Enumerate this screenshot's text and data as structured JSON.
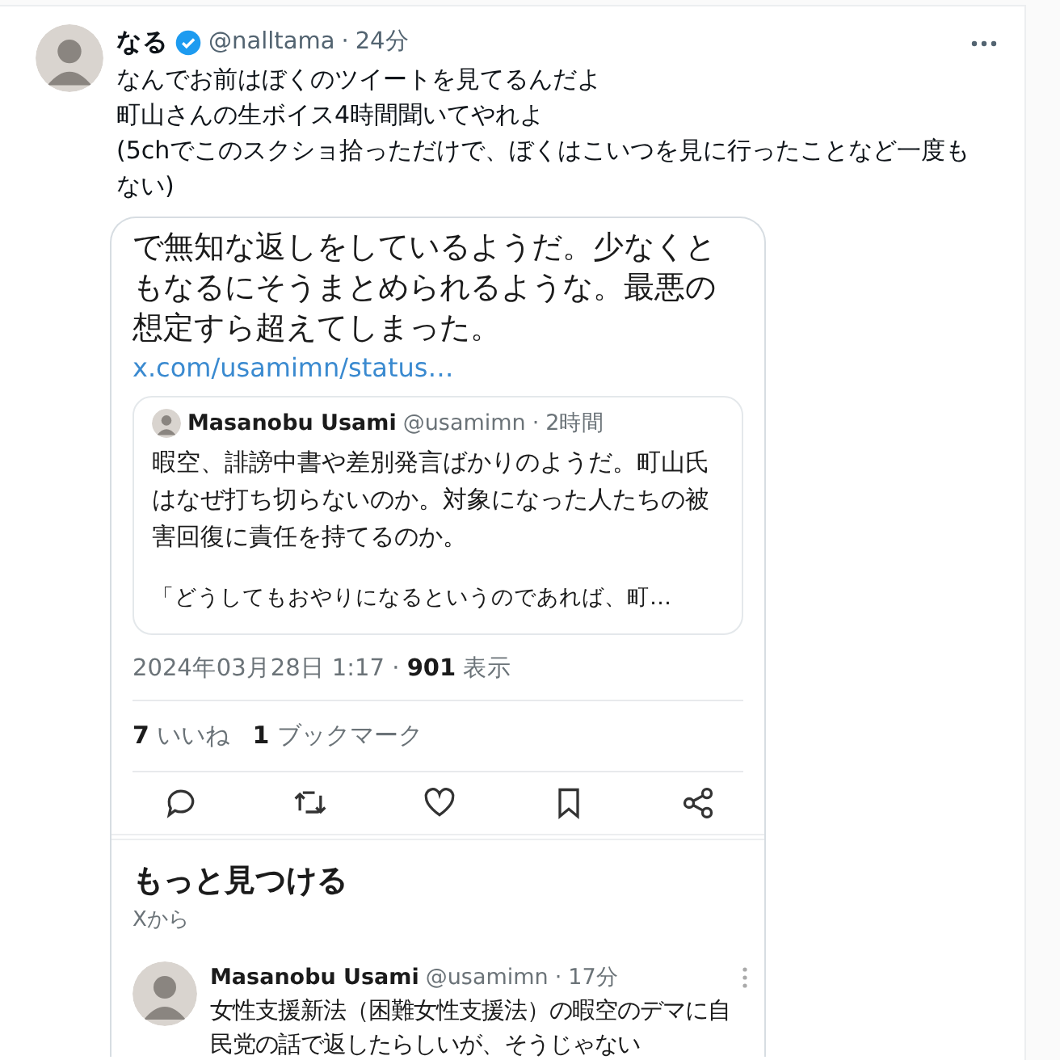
{
  "post": {
    "display_name": "なる",
    "verified": true,
    "handle": "@nalltama",
    "dot": "·",
    "time": "24分",
    "paragraphs": [
      "なんでお前はぼくのツイートを見てるんだよ",
      "町山さんの生ボイス4時間聞いてやれよ",
      "(5chでこのスクショ拾っただけで、ぼくはこいつを見に行ったことなど一度もない)"
    ]
  },
  "attached_screenshot": {
    "text": "で無知な返しをしているようだ。少なくともなるにそうまとめられるような。最悪の想定すら超えてしまった。",
    "link": "x.com/usamimn/status…",
    "quote": {
      "name": "Masanobu Usami",
      "handle": "@usamimn",
      "dot": "·",
      "time": "2時間",
      "paragraphs": [
        "暇空、誹謗中書や差別発言ばかりのようだ。町山氏はなぜ打ち切らないのか。対象になった人たちの被害回復に責任を持てるのか。",
        "「どうしてもおやりになるというのであれば、町…"
      ]
    },
    "meta": "2024年03月28日 1:17 · **901** 表示",
    "stats": [
      "**7** いいね",
      "**1** ブックマーク"
    ],
    "section_title": "もっと見つける",
    "section_subtitle": "Xから",
    "suggested": {
      "name": "Masanobu Usami",
      "handle": "@usamimn",
      "dot": "·",
      "time": "17分",
      "text": "女性支援新法（困難女性支援法）の暇空のデマに自民党の話で返したらしいが、そうじゃない"
    }
  }
}
